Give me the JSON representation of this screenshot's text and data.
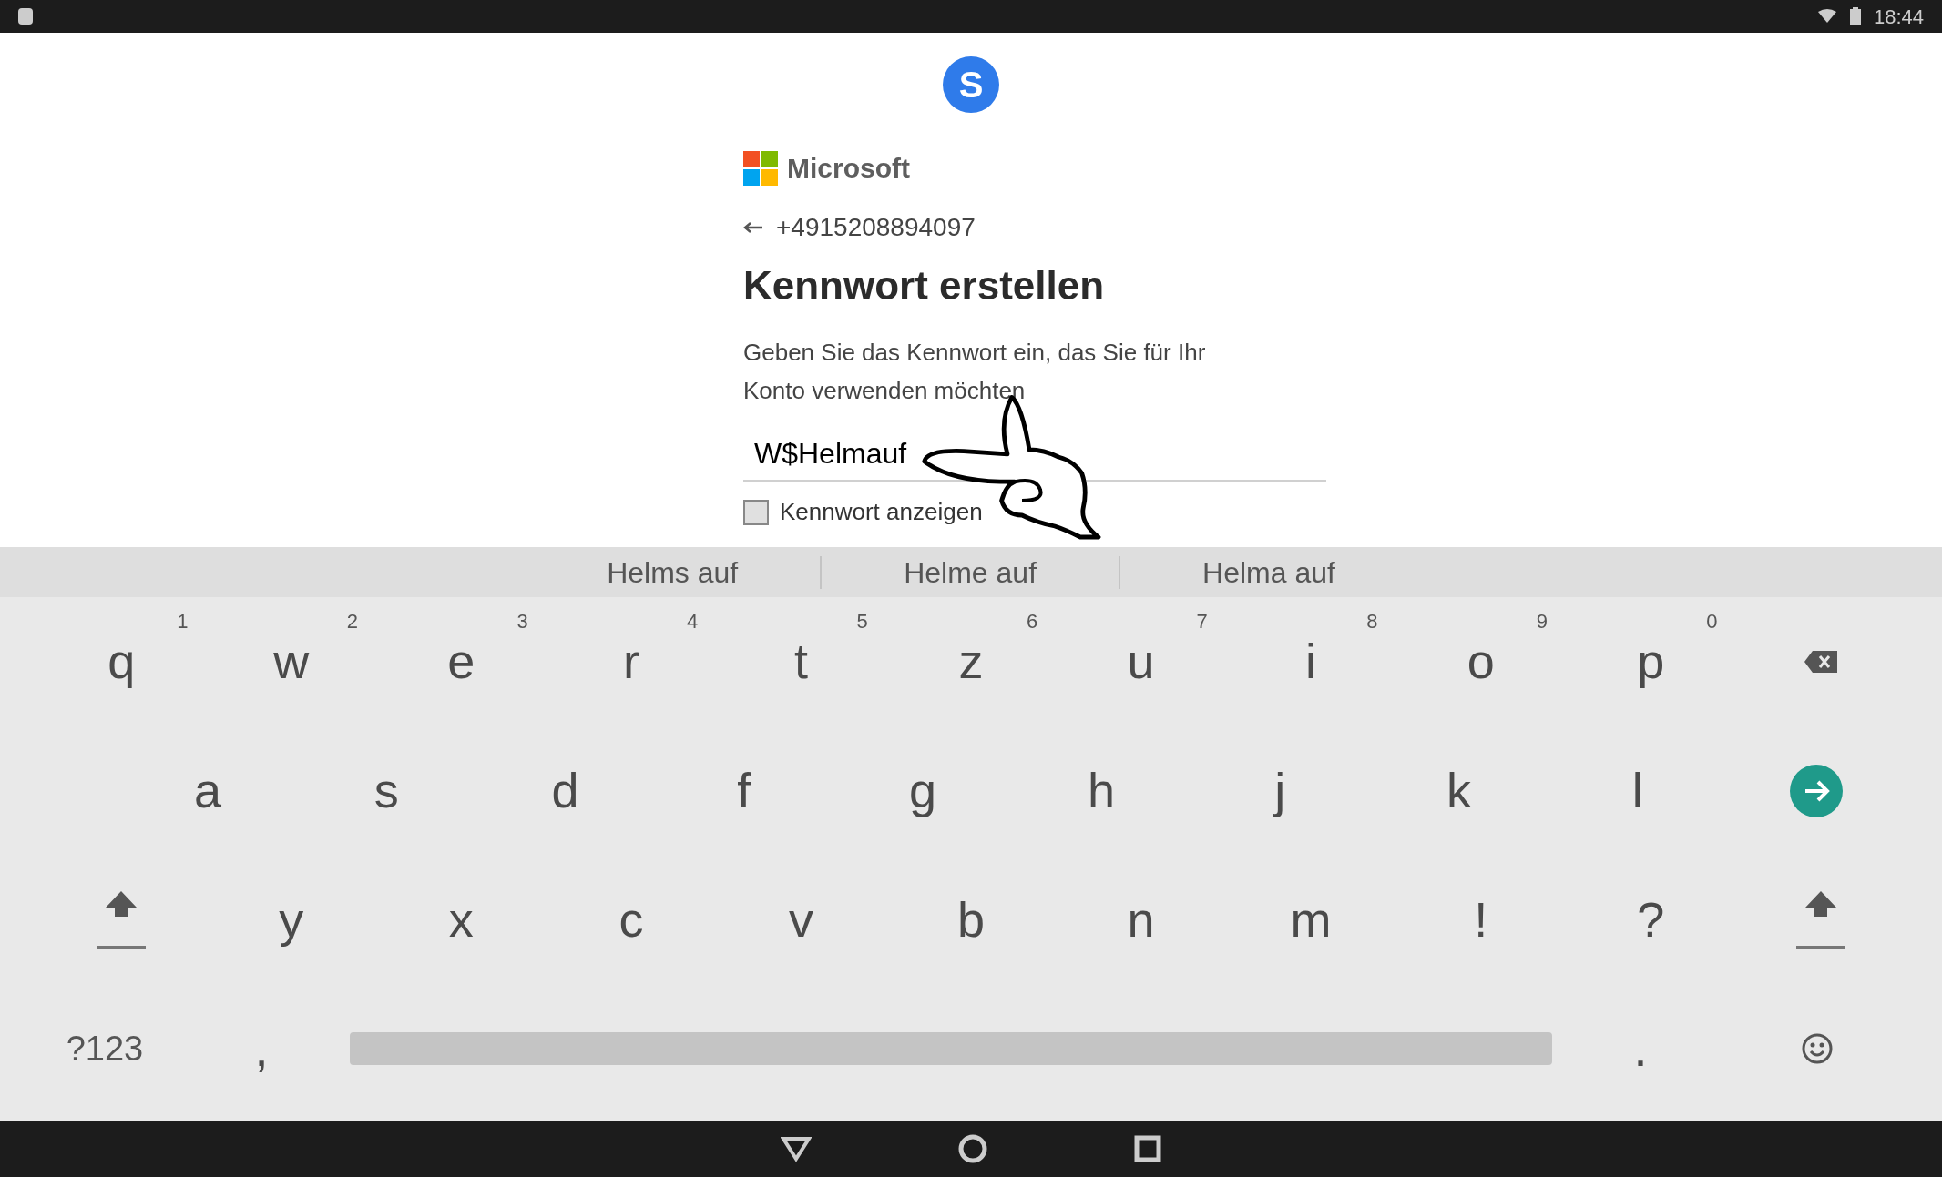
{
  "status_bar": {
    "time": "18:44"
  },
  "app_logo": {
    "letter": "S"
  },
  "brand": "Microsoft",
  "account": "+4915208894097",
  "heading": "Kennwort erstellen",
  "description": [
    "Geben Sie das Kennwort ein, das Sie für Ihr",
    "Konto verwenden möchten"
  ],
  "password_field": {
    "value": "W$Helmauf"
  },
  "show_password": {
    "label": "Kennwort anzeigen",
    "checked": false
  },
  "suggestions": [
    "Helms auf",
    "Helme auf",
    "Helma auf"
  ],
  "keyboard": {
    "rows": [
      [
        {
          "kind": "letter",
          "label": "q",
          "hint": "1"
        },
        {
          "kind": "letter",
          "label": "w",
          "hint": "2"
        },
        {
          "kind": "letter",
          "label": "e",
          "hint": "3"
        },
        {
          "kind": "letter",
          "label": "r",
          "hint": "4"
        },
        {
          "kind": "letter",
          "label": "t",
          "hint": "5"
        },
        {
          "kind": "letter",
          "label": "z",
          "hint": "6"
        },
        {
          "kind": "letter",
          "label": "u",
          "hint": "7"
        },
        {
          "kind": "letter",
          "label": "i",
          "hint": "8"
        },
        {
          "kind": "letter",
          "label": "o",
          "hint": "9"
        },
        {
          "kind": "letter",
          "label": "p",
          "hint": "0"
        },
        {
          "kind": "backspace"
        }
      ],
      [
        {
          "kind": "spacer"
        },
        {
          "kind": "letter",
          "label": "a"
        },
        {
          "kind": "letter",
          "label": "s"
        },
        {
          "kind": "letter",
          "label": "d"
        },
        {
          "kind": "letter",
          "label": "f"
        },
        {
          "kind": "letter",
          "label": "g"
        },
        {
          "kind": "letter",
          "label": "h"
        },
        {
          "kind": "letter",
          "label": "j"
        },
        {
          "kind": "letter",
          "label": "k"
        },
        {
          "kind": "letter",
          "label": "l"
        },
        {
          "kind": "enter"
        }
      ],
      [
        {
          "kind": "shift"
        },
        {
          "kind": "letter",
          "label": "y"
        },
        {
          "kind": "letter",
          "label": "x"
        },
        {
          "kind": "letter",
          "label": "c"
        },
        {
          "kind": "letter",
          "label": "v"
        },
        {
          "kind": "letter",
          "label": "b"
        },
        {
          "kind": "letter",
          "label": "n"
        },
        {
          "kind": "letter",
          "label": "m"
        },
        {
          "kind": "letter",
          "label": "!"
        },
        {
          "kind": "letter",
          "label": "?"
        },
        {
          "kind": "shift"
        }
      ]
    ],
    "bottom_row": [
      {
        "kind": "symbols",
        "label": "?123"
      },
      {
        "kind": "letter",
        "label": ","
      },
      {
        "kind": "space"
      },
      {
        "kind": "letter",
        "label": "."
      },
      {
        "kind": "emoji"
      }
    ]
  }
}
